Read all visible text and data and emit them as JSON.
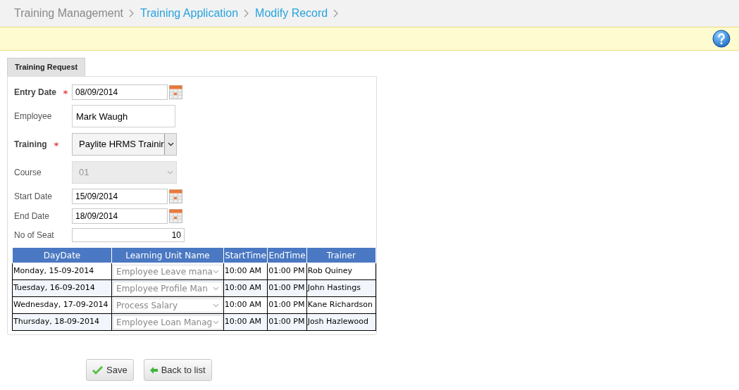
{
  "breadcrumb": [
    {
      "label": "Training Management",
      "kind": "text"
    },
    {
      "label": "Training Application",
      "kind": "link"
    },
    {
      "label": "Modify Record",
      "kind": "link"
    }
  ],
  "tabs": [
    {
      "label": "Training Request",
      "selected": true
    }
  ],
  "fields": [
    {
      "label": "Entry Date",
      "kind": "date",
      "value": "08/09/2014",
      "required": true,
      "disabled": false
    },
    {
      "label": "Employee",
      "kind": "text",
      "value": "Mark Waugh",
      "required": false,
      "disabled": false
    },
    {
      "label": "Training",
      "kind": "select",
      "value": "Paylite HRMS Trainir",
      "required": true,
      "disabled": false
    },
    {
      "label": "Course",
      "kind": "select",
      "value": "01",
      "required": false,
      "disabled": true
    },
    {
      "label": "Start Date",
      "kind": "date",
      "value": "15/09/2014",
      "required": false,
      "disabled": false
    },
    {
      "label": "End Date",
      "kind": "date",
      "value": "18/09/2014",
      "required": false,
      "disabled": false
    },
    {
      "label": "No of Seat",
      "kind": "number",
      "value": "10",
      "required": false,
      "disabled": false
    }
  ],
  "table": {
    "columns": [
      "DayDate",
      "Learning Unit Name",
      "StartTime",
      "EndTime",
      "Trainer"
    ],
    "rows": [
      {
        "day_date": "Monday, 15-09-2014",
        "learning_unit": "Employee Leave mana",
        "start_time": "10:00 AM",
        "end_time": "01:00 PM",
        "trainer": "Rob Quiney"
      },
      {
        "day_date": "Tuesday, 16-09-2014",
        "learning_unit": "Employee Profile Man",
        "start_time": "10:00 AM",
        "end_time": "01:00 PM",
        "trainer": "John Hastings"
      },
      {
        "day_date": "Wednesday, 17-09-2014",
        "learning_unit": "Process Salary",
        "start_time": "10:00 AM",
        "end_time": "01:00 PM",
        "trainer": "Kane Richardson"
      },
      {
        "day_date": "Thursday, 18-09-2014",
        "learning_unit": "Employee Loan Manag",
        "start_time": "10:00 AM",
        "end_time": "01:00 PM",
        "trainer": "Josh Hazlewood"
      }
    ]
  },
  "buttons": [
    {
      "label": "Save",
      "kind": "save"
    },
    {
      "label": "Back to list",
      "kind": "back"
    }
  ]
}
